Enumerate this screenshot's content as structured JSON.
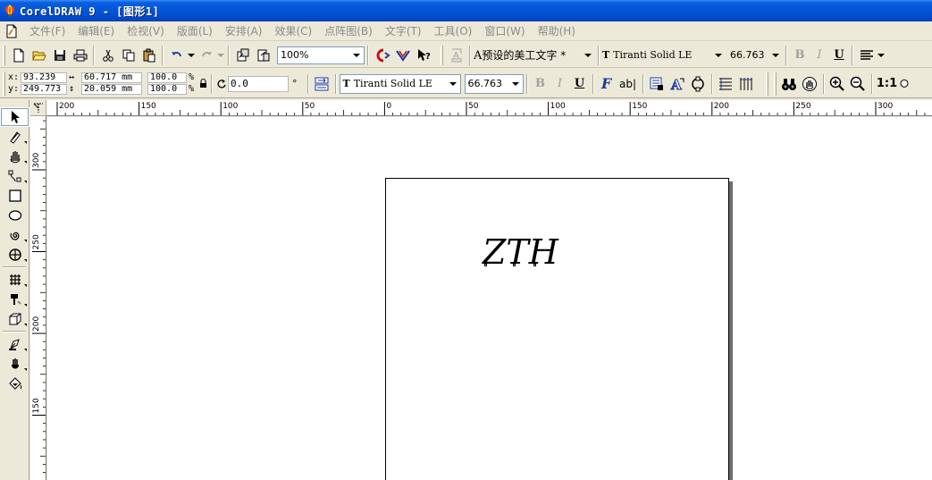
{
  "window": {
    "title": "CorelDRAW 9 - [图形1]"
  },
  "menu": [
    {
      "label": "文件(F)"
    },
    {
      "label": "编辑(E)"
    },
    {
      "label": "检视(V)"
    },
    {
      "label": "版面(L)"
    },
    {
      "label": "安排(A)"
    },
    {
      "label": "效果(C)"
    },
    {
      "label": "点阵图(B)"
    },
    {
      "label": "文字(T)"
    },
    {
      "label": "工具(O)"
    },
    {
      "label": "窗口(W)"
    },
    {
      "label": "帮助(H)"
    }
  ],
  "standard_toolbar": {
    "zoom": "100%",
    "text_style": "预设的美工文字 *",
    "font": "Tiranti Solid LE",
    "font_size": "66.763",
    "bold": "B",
    "italic": "I",
    "underline": "U"
  },
  "property_bar": {
    "x_label": "x:",
    "y_label": "y:",
    "x": "93.239",
    "y": "249.773",
    "width": "60.717 mm",
    "height": "20.059 mm",
    "scale_x": "100.0",
    "scale_y": "100.0",
    "percent": "%",
    "rotation": "0.0",
    "degree": "°",
    "font": "Tiranti Solid LE",
    "font_size": "66.763",
    "bold": "B",
    "italic": "I",
    "underline": "U",
    "format_text": "F",
    "edit_text": "ab|",
    "zoom_one": "1:1"
  },
  "rulers": {
    "h_labels": [
      "200",
      "150",
      "100",
      "50",
      "0",
      "50",
      "100",
      "150",
      "200",
      "250",
      "300"
    ],
    "v_labels": [
      "300",
      "250",
      "200",
      "150"
    ]
  },
  "document": {
    "artwork_text": "ZTH"
  },
  "colors": {
    "titlebar": "#0554d8",
    "chrome": "#ece9d8",
    "menu_disabled": "#8a8a8a"
  }
}
